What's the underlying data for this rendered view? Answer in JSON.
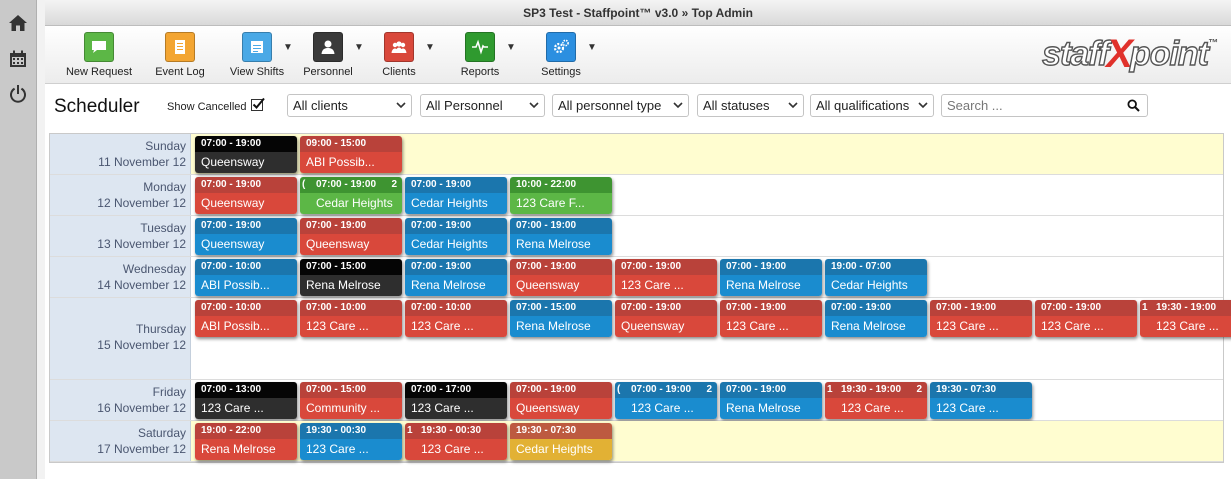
{
  "window": {
    "title": "SP3 Test - Staffpoint™ v3.0  »  Top Admin"
  },
  "rail": {
    "icons": [
      "home-icon",
      "calendar-icon",
      "power-icon"
    ]
  },
  "toolbar": {
    "items": [
      {
        "label": "New Request",
        "icon": "chat-icon",
        "color": "#5cb746",
        "caret": false
      },
      {
        "label": "Event Log",
        "icon": "log-icon",
        "color": "#f3a532",
        "caret": false
      },
      {
        "label": "View Shifts",
        "icon": "shifts-icon",
        "color": "#4aa9e6",
        "caret": true
      },
      {
        "label": "Personnel",
        "icon": "person-icon",
        "color": "#3a3a3a",
        "caret": true
      },
      {
        "label": "Clients",
        "icon": "group-icon",
        "color": "#d9483b",
        "caret": true
      },
      {
        "label": "Reports",
        "icon": "pulse-icon",
        "color": "#2f9a2f",
        "caret": true
      },
      {
        "label": "Settings",
        "icon": "gears-icon",
        "color": "#2c8fe0",
        "caret": true
      }
    ],
    "logo": {
      "left": "staff",
      "x": "X",
      "right": "point",
      "tm": "™"
    }
  },
  "filters": {
    "page_title": "Scheduler",
    "show_cancelled": "Show Cancelled",
    "clients": "All clients",
    "personnel": "All Personnel",
    "personnel_type": "All personnel type",
    "statuses": "All statuses",
    "qualifications": "All qualifications",
    "search_placeholder": "Search ..."
  },
  "schedule": {
    "days": [
      {
        "name": "Sunday",
        "date": "11 November 12",
        "weekend": true,
        "shifts": [
          {
            "time": "07:00 - 19:00",
            "name": "Queensway",
            "color": "black"
          },
          {
            "time": "09:00 - 15:00",
            "name": "ABI Possib...",
            "color": "red"
          }
        ]
      },
      {
        "name": "Monday",
        "date": "12 November 12",
        "weekend": false,
        "shifts": [
          {
            "time": "07:00 - 19:00",
            "name": "Queensway",
            "color": "red"
          },
          {
            "time": "07:00 - 19:00",
            "name": "Cedar Heights",
            "color": "green",
            "count": "2",
            "lead": "("
          },
          {
            "time": "07:00 - 19:00",
            "name": "Cedar Heights",
            "color": "blue"
          },
          {
            "time": "10:00 - 22:00",
            "name": "123 Care F...",
            "color": "green"
          }
        ]
      },
      {
        "name": "Tuesday",
        "date": "13 November 12",
        "weekend": false,
        "shifts": [
          {
            "time": "07:00 - 19:00",
            "name": "Queensway",
            "color": "blue"
          },
          {
            "time": "07:00 - 19:00",
            "name": "Queensway",
            "color": "red"
          },
          {
            "time": "07:00 - 19:00",
            "name": "Cedar Heights",
            "color": "blue"
          },
          {
            "time": "07:00 - 19:00",
            "name": "Rena Melrose",
            "color": "blue"
          }
        ]
      },
      {
        "name": "Wednesday",
        "date": "14 November 12",
        "weekend": false,
        "shifts": [
          {
            "time": "07:00 - 10:00",
            "name": "ABI Possib...",
            "color": "blue"
          },
          {
            "time": "07:00 - 15:00",
            "name": "Rena Melrose",
            "color": "black"
          },
          {
            "time": "07:00 - 19:00",
            "name": "Rena Melrose",
            "color": "blue"
          },
          {
            "time": "07:00 - 19:00",
            "name": "Queensway",
            "color": "red"
          },
          {
            "time": "07:00 - 19:00",
            "name": "123 Care ...",
            "color": "red"
          },
          {
            "time": "07:00 - 19:00",
            "name": "Rena Melrose",
            "color": "blue"
          },
          {
            "time": "19:00 - 07:00",
            "name": "Cedar Heights",
            "color": "blue"
          }
        ]
      },
      {
        "name": "Thursday",
        "date": "15 November 12",
        "weekend": false,
        "shifts": [
          {
            "time": "07:00 - 10:00",
            "name": "ABI Possib...",
            "color": "red"
          },
          {
            "time": "07:00 - 10:00",
            "name": "123 Care ...",
            "color": "red"
          },
          {
            "time": "07:00 - 10:00",
            "name": "123 Care ...",
            "color": "red"
          },
          {
            "time": "07:00 - 15:00",
            "name": "Rena Melrose",
            "color": "blue"
          },
          {
            "time": "07:00 - 19:00",
            "name": "Queensway",
            "color": "red"
          },
          {
            "time": "07:00 - 19:00",
            "name": "123 Care ...",
            "color": "red"
          },
          {
            "time": "07:00 - 19:00",
            "name": "Rena Melrose",
            "color": "blue"
          },
          {
            "time": "07:00 - 19:00",
            "name": "123 Care ...",
            "color": "red"
          },
          {
            "time": "07:00 - 19:00",
            "name": "123 Care ...",
            "color": "red"
          },
          {
            "time": "19:30 - 19:00",
            "name": "123 Care ...",
            "color": "red",
            "count": "3",
            "lead": "1"
          }
        ]
      },
      {
        "name": "Friday",
        "date": "16 November 12",
        "weekend": false,
        "shifts": [
          {
            "time": "07:00 - 13:00",
            "name": "123 Care ...",
            "color": "black"
          },
          {
            "time": "07:00 - 15:00",
            "name": "Community ...",
            "color": "red"
          },
          {
            "time": "07:00 - 17:00",
            "name": "123 Care ...",
            "color": "black"
          },
          {
            "time": "07:00 - 19:00",
            "name": "Queensway",
            "color": "red"
          },
          {
            "time": "07:00 - 19:00",
            "name": "123 Care ...",
            "color": "blue",
            "count": "2",
            "lead": "("
          },
          {
            "time": "07:00 - 19:00",
            "name": "Rena Melrose",
            "color": "blue"
          },
          {
            "time": "19:30 - 19:00",
            "name": "123 Care ...",
            "color": "red",
            "count": "2",
            "lead": "1"
          },
          {
            "time": "19:30 - 07:30",
            "name": "123 Care ...",
            "color": "blue"
          }
        ]
      },
      {
        "name": "Saturday",
        "date": "17 November 12",
        "weekend": true,
        "shifts": [
          {
            "time": "19:00 - 22:00",
            "name": "Rena Melrose",
            "color": "red"
          },
          {
            "time": "19:30 - 00:30",
            "name": "123 Care ...",
            "color": "blue"
          },
          {
            "time": "19:30 - 00:30",
            "name": "123 Care ...",
            "color": "red",
            "count": "",
            "lead": "1"
          },
          {
            "time": "19:30 - 07:30",
            "name": "Cedar Heights",
            "color": "yellow"
          }
        ]
      }
    ]
  }
}
